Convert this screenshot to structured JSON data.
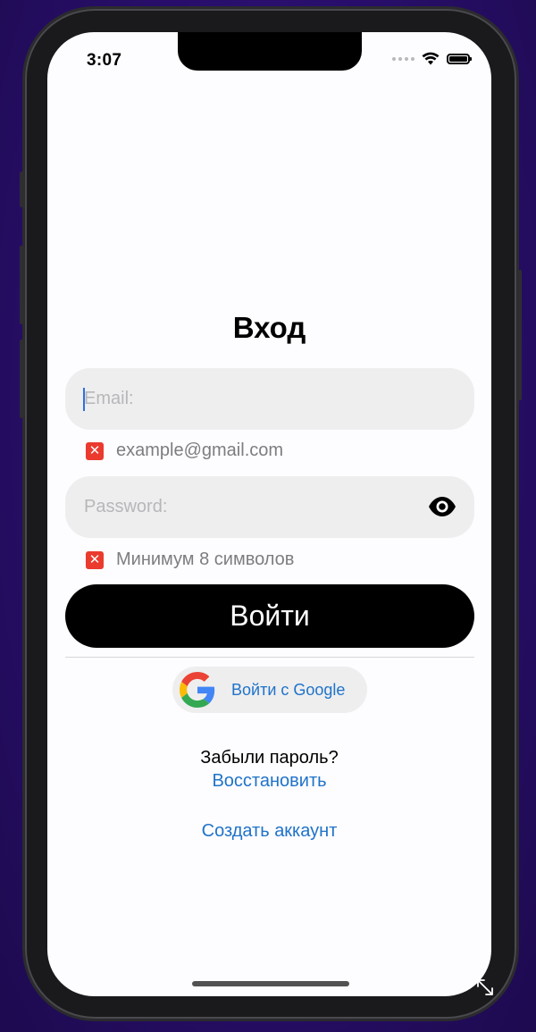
{
  "status_bar": {
    "time": "3:07",
    "wifi_icon": "wifi-icon",
    "battery_icon": "battery-icon"
  },
  "login": {
    "title": "Вход",
    "email": {
      "placeholder": "Email:",
      "value": ""
    },
    "email_hint": {
      "icon": "error-x-icon",
      "text": "example@gmail.com"
    },
    "password": {
      "placeholder": "Password:",
      "value": "",
      "toggle_icon": "eye-icon"
    },
    "password_hint": {
      "icon": "error-x-icon",
      "text": "Минимум 8 символов"
    },
    "submit_label": "Войти",
    "google_label": "Войти с Google",
    "forgot_text": "Забыли пароль?",
    "restore_link": "Восстановить",
    "create_account_link": "Создать аккаунт"
  },
  "colors": {
    "accent": "#1f73c9",
    "error": "#ea3b2e",
    "field_bg": "#eeeeef",
    "button_bg": "#000000",
    "background": "#2a0f6e"
  }
}
